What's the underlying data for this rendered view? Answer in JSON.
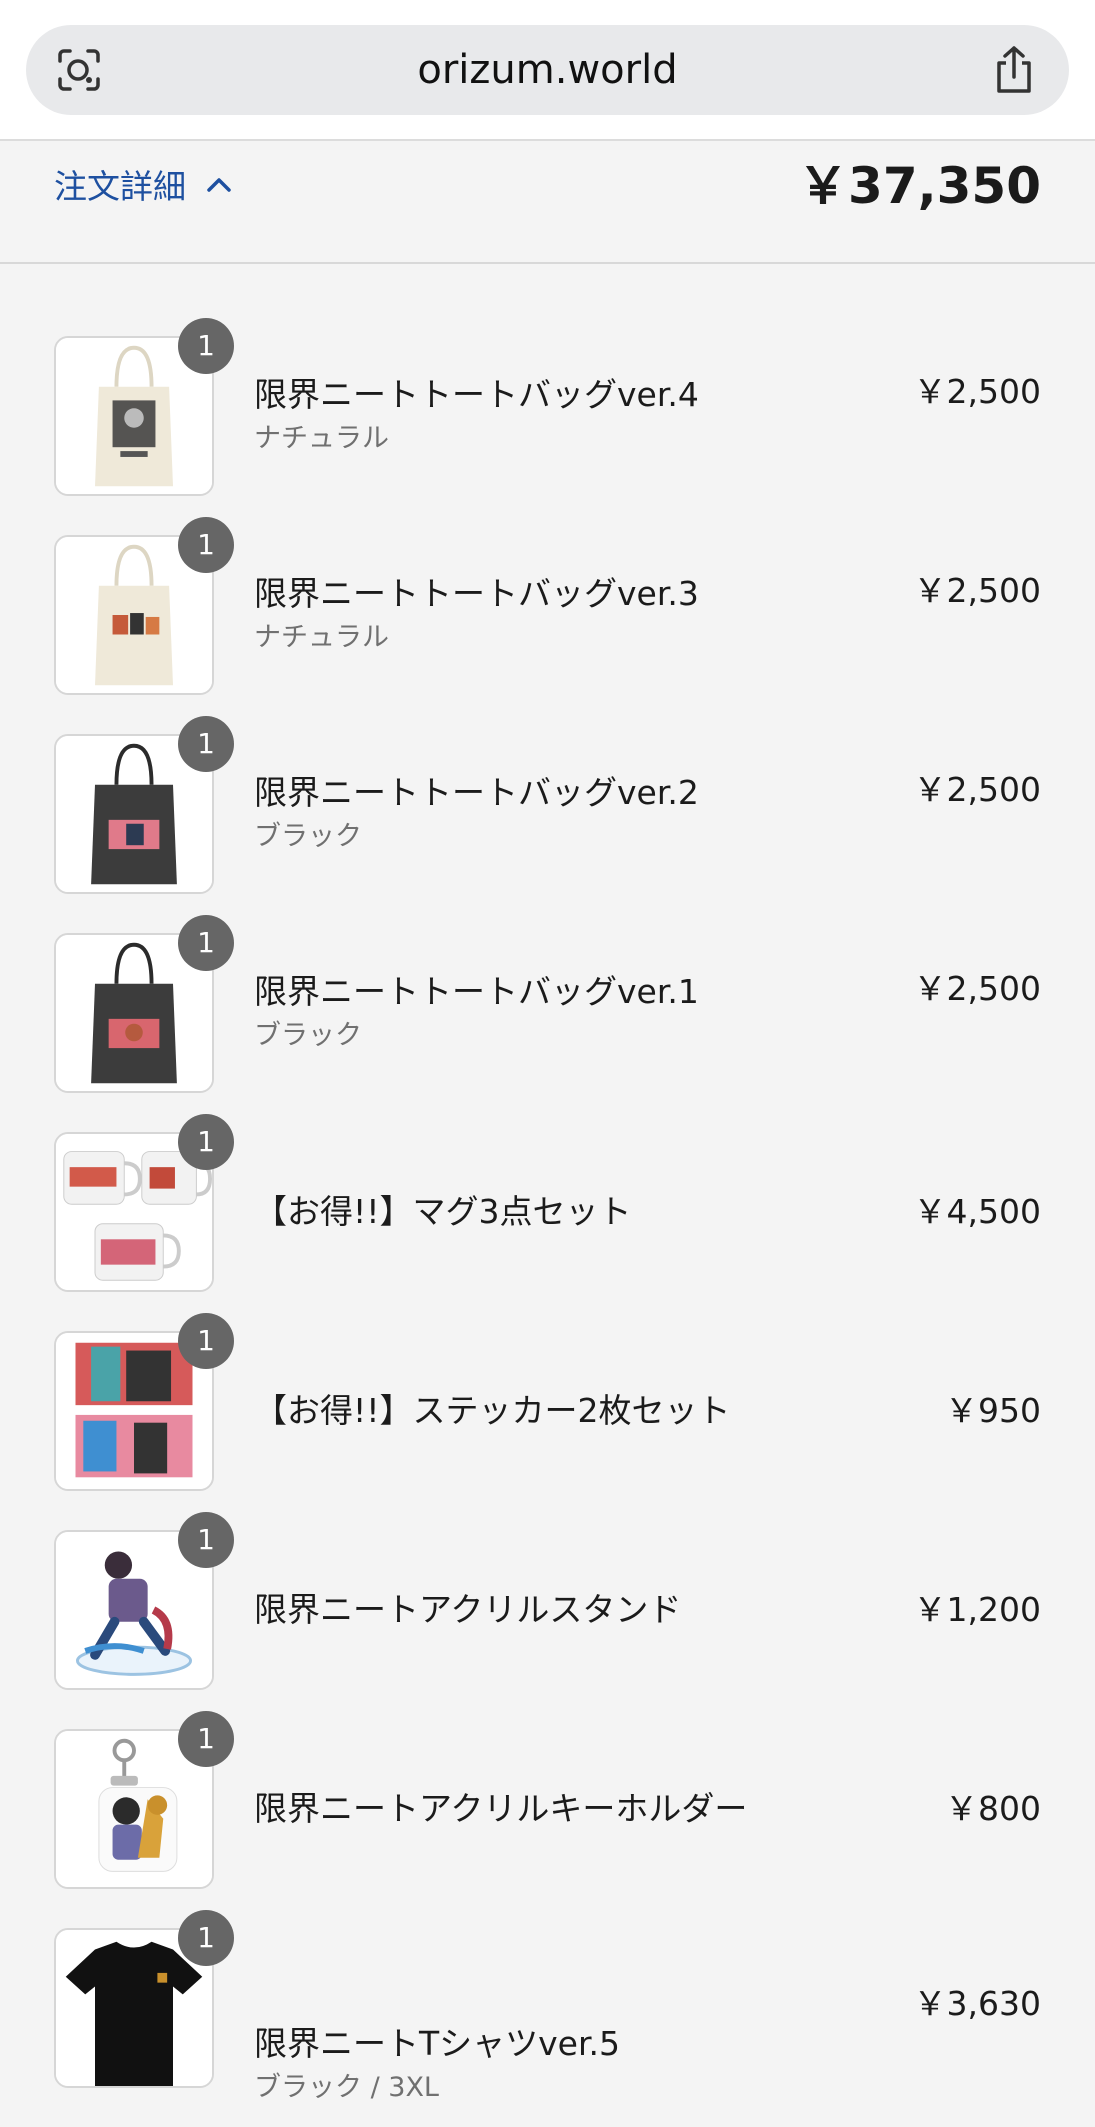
{
  "browser": {
    "url": "orizum.world",
    "lens_icon": "camera-search-icon",
    "share_icon": "share-icon"
  },
  "summary": {
    "toggle_label": "注文詳細",
    "total": "￥37,350",
    "chevron_icon": "chevron-up-icon"
  },
  "items": [
    {
      "qty": "1",
      "title": "限界ニートトートバッグver.4",
      "variant": "ナチュラル",
      "price": "￥2,500"
    },
    {
      "qty": "1",
      "title": "限界ニートトートバッグver.3",
      "variant": "ナチュラル",
      "price": "￥2,500"
    },
    {
      "qty": "1",
      "title": "限界ニートトートバッグver.2",
      "variant": "ブラック",
      "price": "￥2,500"
    },
    {
      "qty": "1",
      "title": "限界ニートトートバッグver.1",
      "variant": "ブラック",
      "price": "￥2,500"
    },
    {
      "qty": "1",
      "title": "【お得!!】マグ3点セット",
      "variant": "",
      "price": "￥4,500"
    },
    {
      "qty": "1",
      "title": "【お得!!】ステッカー2枚セット",
      "variant": "",
      "price": "￥950"
    },
    {
      "qty": "1",
      "title": "限界ニートアクリルスタンド",
      "variant": "",
      "price": "￥1,200"
    },
    {
      "qty": "1",
      "title": "限界ニートアクリルキーホルダー",
      "variant": "",
      "price": "￥800"
    },
    {
      "qty": "1",
      "title": "限界ニートTシャツver.5",
      "variant": "ブラック / 3XL",
      "price": "￥3,630"
    }
  ]
}
